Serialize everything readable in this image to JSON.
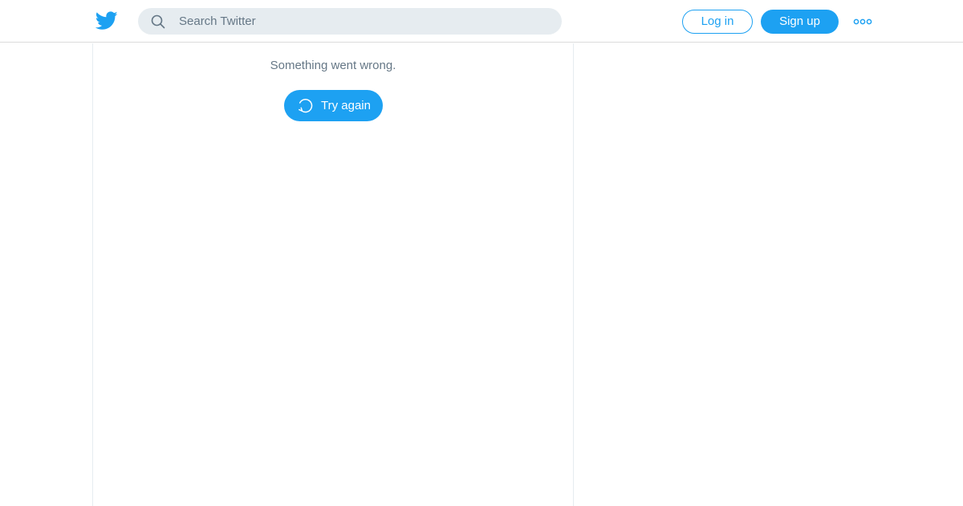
{
  "header": {
    "logo_icon": "twitter-bird-icon",
    "search": {
      "icon": "search-icon",
      "placeholder": "Search Twitter",
      "value": ""
    },
    "login_label": "Log in",
    "signup_label": "Sign up",
    "more_icon": "more-dots-icon"
  },
  "main": {
    "error_message": "Something went wrong.",
    "retry_icon": "refresh-icon",
    "retry_label": "Try again"
  },
  "colors": {
    "accent": "#1da1f2",
    "search_bg": "#e6ecf0",
    "secondary_text": "#657786",
    "divider": "#e6ecf0"
  }
}
